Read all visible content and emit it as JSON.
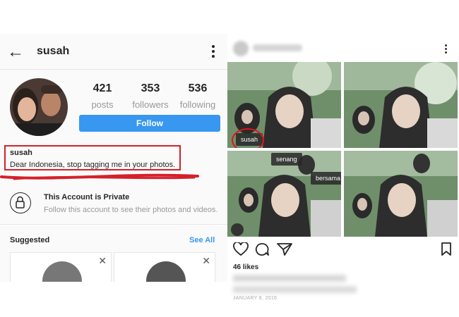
{
  "profile": {
    "back_icon": "back-arrow-icon",
    "username": "susah",
    "menu_icon": "more-vertical-icon",
    "stats": [
      {
        "value": "421",
        "label": "posts"
      },
      {
        "value": "353",
        "label": "followers"
      },
      {
        "value": "536",
        "label": "following"
      }
    ],
    "follow_label": "Follow",
    "bio": {
      "name": "susah",
      "text": "Dear Indonesia, stop tagging me in your photos."
    },
    "private": {
      "icon": "lock-icon",
      "title": "This Account is Private",
      "description": "Follow this account to see their photos and videos."
    },
    "suggested": {
      "title": "Suggested",
      "see_all": "See All"
    }
  },
  "post": {
    "menu_icon": "more-vertical-icon",
    "tags": {
      "circled": "susah",
      "senang": "senang",
      "bersama": "bersama"
    },
    "action_icons": [
      "heart-icon",
      "comment-icon",
      "share-icon",
      "bookmark-icon"
    ],
    "likes": "46 likes",
    "date": "JANUARY 8, 2016"
  },
  "colors": {
    "accent_blue": "#3897f0",
    "annotation_red": "#e0141e"
  }
}
